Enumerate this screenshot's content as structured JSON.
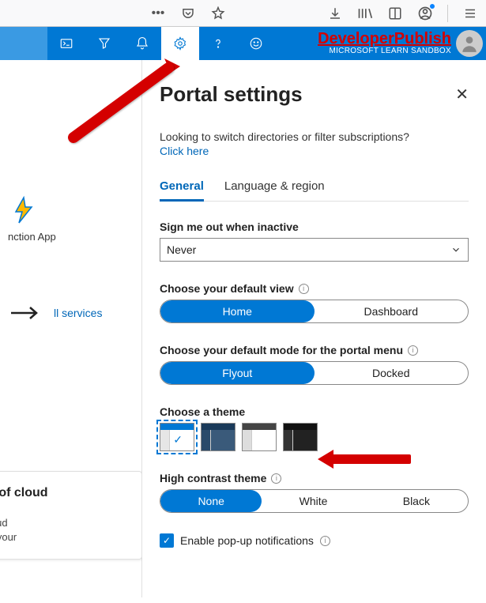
{
  "browser": {
    "more_icon": "more",
    "pocket_icon": "pocket",
    "star_icon": "star",
    "download_icon": "download",
    "library_icon": "library",
    "reader_icon": "reader",
    "account_icon": "account",
    "menu_icon": "menu"
  },
  "topbar": {
    "cloudshell_icon": "cloud-shell",
    "directory_icon": "directory-filter",
    "notifications_icon": "notifications",
    "settings_icon": "settings",
    "help_icon": "help",
    "feedback_icon": "feedback",
    "brand_main": "DeveloperPublish",
    "brand_sub": "MICROSOFT LEARN SANDBOX"
  },
  "left": {
    "function_app": "nction App",
    "all_services": "ll services",
    "card_title": "s of cloud",
    "card_line1": "loud",
    "card_line2": "n your"
  },
  "panel": {
    "title": "Portal settings",
    "hint": "Looking to switch directories or filter subscriptions?",
    "hint_link": "Click here",
    "tabs": {
      "general": "General",
      "lang": "Language & region"
    },
    "signout": {
      "label": "Sign me out when inactive",
      "value": "Never"
    },
    "default_view": {
      "label": "Choose your default view",
      "opt1": "Home",
      "opt2": "Dashboard"
    },
    "menu_mode": {
      "label": "Choose your default mode for the portal menu",
      "opt1": "Flyout",
      "opt2": "Docked"
    },
    "theme": {
      "label": "Choose a theme"
    },
    "contrast": {
      "label": "High contrast theme",
      "opt1": "None",
      "opt2": "White",
      "opt3": "Black"
    },
    "popups": {
      "label": "Enable pop-up notifications"
    }
  }
}
